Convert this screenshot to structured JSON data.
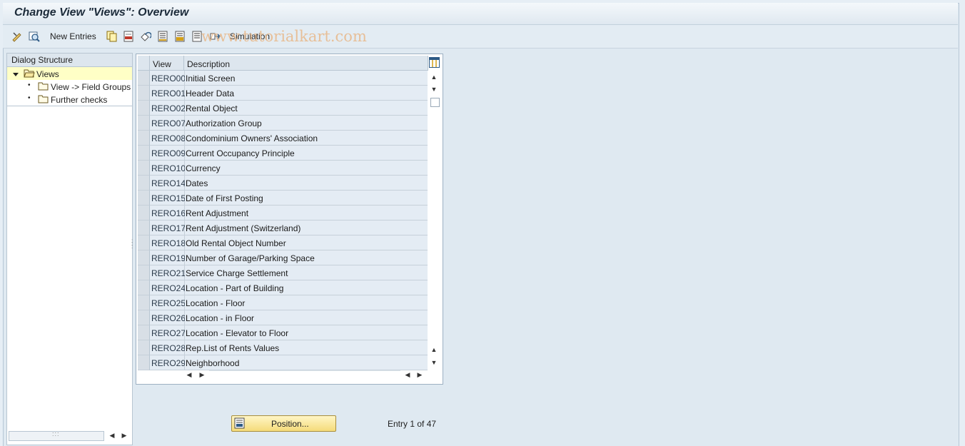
{
  "window": {
    "title": "Change View \"Views\": Overview"
  },
  "toolbar": {
    "new_entries_label": "New Entries",
    "simulation_label": "Simulation",
    "watermark": "www.tutorialkart.com",
    "icons": [
      "display-change-icon",
      "details-icon",
      "copy-icon",
      "delete-icon",
      "undo-icon",
      "select-all-icon",
      "select-block-icon",
      "deselect-all-icon",
      "simulation-icon"
    ]
  },
  "dialog_structure": {
    "header": "Dialog Structure",
    "items": [
      {
        "label": "Views",
        "selected": true,
        "expanded": true
      },
      {
        "label": "View -> Field Groups",
        "selected": false
      },
      {
        "label": "Further checks",
        "selected": false
      }
    ]
  },
  "table": {
    "columns": {
      "view": "View",
      "description": "Description"
    },
    "rows": [
      {
        "view": "RERO00",
        "description": "Initial Screen"
      },
      {
        "view": "RERO01",
        "description": "Header Data"
      },
      {
        "view": "RERO02",
        "description": "Rental Object"
      },
      {
        "view": "RERO07",
        "description": "Authorization Group"
      },
      {
        "view": "RERO08",
        "description": "Condominium Owners' Association"
      },
      {
        "view": "RERO09",
        "description": "Current Occupancy Principle"
      },
      {
        "view": "RERO10",
        "description": "Currency"
      },
      {
        "view": "RERO14",
        "description": "Dates"
      },
      {
        "view": "RERO15",
        "description": "Date of First Posting"
      },
      {
        "view": "RERO16",
        "description": "Rent Adjustment"
      },
      {
        "view": "RERO17",
        "description": "Rent Adjustment (Switzerland)"
      },
      {
        "view": "RERO18",
        "description": "Old Rental Object Number"
      },
      {
        "view": "RERO19",
        "description": "Number of Garage/Parking Space"
      },
      {
        "view": "RERO21",
        "description": "Service Charge Settlement"
      },
      {
        "view": "RERO24",
        "description": "Location - Part of Building"
      },
      {
        "view": "RERO25",
        "description": "Location - Floor"
      },
      {
        "view": "RERO26",
        "description": "Location - in Floor"
      },
      {
        "view": "RERO27",
        "description": "Location - Elevator to Floor"
      },
      {
        "view": "RERO28",
        "description": "Rep.List of Rents Values"
      },
      {
        "view": "RERO29",
        "description": "Neighborhood"
      }
    ]
  },
  "footer": {
    "position_button": "Position...",
    "entry_info": "Entry 1 of 47"
  },
  "colors": {
    "accent": "#f5db7a",
    "selection": "#ffffc6",
    "row_bg": "#e4ecf4"
  }
}
